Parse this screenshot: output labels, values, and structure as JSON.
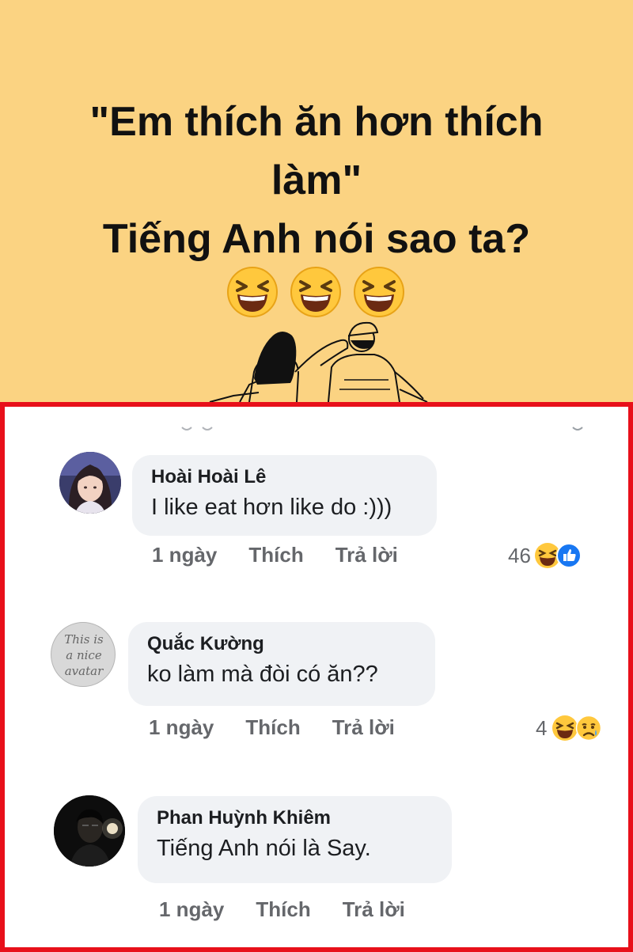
{
  "banner": {
    "headline_lines": [
      "\"Em thích ăn hơn thích",
      "làm\"",
      "Tiếng Anh nói sao ta?"
    ],
    "emoji": "laughing-face-emoji",
    "background_color": "#fbd382"
  },
  "comments": [
    {
      "author": "Hoài Hoài Lê",
      "text": "I like eat hơn like do :)))",
      "time": "1 ngày",
      "like_label": "Thích",
      "reply_label": "Trả lời",
      "reaction_count": "46",
      "reaction_icons": [
        "haha-reaction-icon",
        "like-reaction-icon"
      ]
    },
    {
      "author": "Quắc Kường",
      "text": "ko làm mà đòi có ăn??",
      "time": "1 ngày",
      "like_label": "Thích",
      "reply_label": "Trả lời",
      "reaction_count": "4",
      "reaction_icons": [
        "haha-reaction-icon",
        "sad-reaction-icon"
      ],
      "avatar_text": [
        "This is",
        "a nice",
        "avatar"
      ]
    },
    {
      "author": "Phan Huỳnh Khiêm",
      "text": "Tiếng Anh nói là Say.",
      "time": "1 ngày",
      "like_label": "Thích",
      "reply_label": "Trả lời"
    }
  ],
  "colors": {
    "highlight_border": "#e8101a",
    "bubble": "#f0f2f5",
    "muted_text": "#65676b",
    "like_blue": "#1877f2"
  }
}
